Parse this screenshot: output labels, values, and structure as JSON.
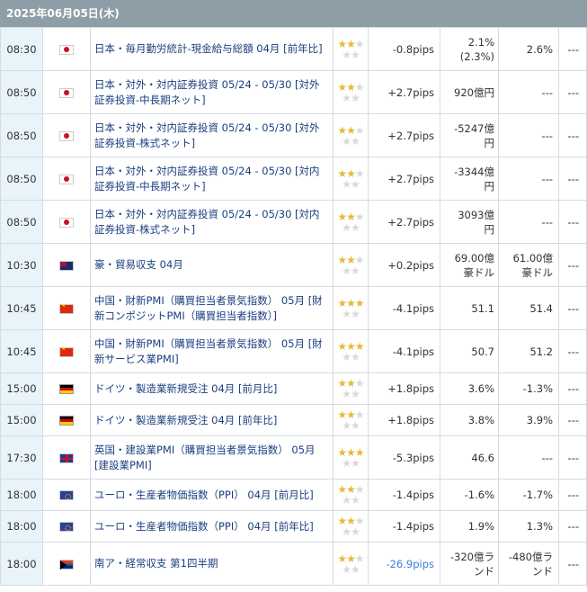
{
  "header": {
    "date": "2025年06月05日(木)"
  },
  "rows": [
    {
      "time": "08:30",
      "flag": "jp",
      "name": "日本・毎月勤労統計-現金給与総額 04月 [前年比]",
      "stars": 2,
      "pips": "-0.8pips",
      "val": "2.1%",
      "val_sub": "(2.3%)",
      "prev": "2.6%",
      "prev2": "---",
      "h": 48
    },
    {
      "time": "08:50",
      "flag": "jp",
      "name": "日本・対外・対内証券投資 05/24 - 05/30 [対外証券投資-中長期ネット]",
      "stars": 2,
      "pips": "+2.7pips",
      "val": "920億円",
      "val_sub": "",
      "prev": "---",
      "prev2": "---",
      "h": 48
    },
    {
      "time": "08:50",
      "flag": "jp",
      "name": "日本・対外・対内証券投資 05/24 - 05/30 [対外証券投資-株式ネット]",
      "stars": 2,
      "pips": "+2.7pips",
      "val": "-5247億",
      "val_sub": "円",
      "prev": "---",
      "prev2": "---",
      "h": 48
    },
    {
      "time": "08:50",
      "flag": "jp",
      "name": "日本・対外・対内証券投資 05/24 - 05/30 [対内証券投資-中長期ネット]",
      "stars": 2,
      "pips": "+2.7pips",
      "val": "-3344億",
      "val_sub": "円",
      "prev": "---",
      "prev2": "---",
      "h": 48
    },
    {
      "time": "08:50",
      "flag": "jp",
      "name": "日本・対外・対内証券投資 05/24 - 05/30 [対内証券投資-株式ネット]",
      "stars": 2,
      "pips": "+2.7pips",
      "val": "3093億",
      "val_sub": "円",
      "prev": "---",
      "prev2": "---",
      "h": 48
    },
    {
      "time": "10:30",
      "flag": "au",
      "name": "豪・貿易収支 04月",
      "stars": 2,
      "pips": "+0.2pips",
      "val": "69.00億",
      "val_sub": "豪ドル",
      "prev": "61.00億",
      "prev_sub": "豪ドル",
      "prev2": "---",
      "h": 48
    },
    {
      "time": "10:45",
      "flag": "cn",
      "name": "中国・財新PMI（購買担当者景気指数） 05月 [財新コンポジットPMI（購買担当者指数）]",
      "stars": 3,
      "pips": "-4.1pips",
      "val": "51.1",
      "val_sub": "",
      "prev": "51.4",
      "prev2": "---",
      "h": 48
    },
    {
      "time": "10:45",
      "flag": "cn",
      "name": "中国・財新PMI（購買担当者景気指数） 05月 [財新サービス業PMI]",
      "stars": 3,
      "pips": "-4.1pips",
      "val": "50.7",
      "val_sub": "",
      "prev": "51.2",
      "prev2": "---",
      "h": 48
    },
    {
      "time": "15:00",
      "flag": "de",
      "name": "ドイツ・製造業新規受注 04月 [前月比]",
      "stars": 2,
      "pips": "+1.8pips",
      "val": "3.6%",
      "val_sub": "",
      "prev": "-1.3%",
      "prev2": "---",
      "h": 35
    },
    {
      "time": "15:00",
      "flag": "de",
      "name": "ドイツ・製造業新規受注 04月 [前年比]",
      "stars": 2,
      "pips": "+1.8pips",
      "val": "3.8%",
      "val_sub": "",
      "prev": "3.9%",
      "prev2": "---",
      "h": 35
    },
    {
      "time": "17:30",
      "flag": "gb",
      "name": "英国・建設業PMI（購買担当者景気指数） 05月 [建設業PMI]",
      "stars": 3,
      "pips": "-5.3pips",
      "val": "46.6",
      "val_sub": "",
      "prev": "---",
      "prev2": "---",
      "h": 48
    },
    {
      "time": "18:00",
      "flag": "eu",
      "name": "ユーロ・生産者物価指数（PPI） 04月 [前月比]",
      "stars": 2,
      "pips": "-1.4pips",
      "val": "-1.6%",
      "val_sub": "",
      "prev": "-1.7%",
      "prev2": "---",
      "h": 35
    },
    {
      "time": "18:00",
      "flag": "eu",
      "name": "ユーロ・生産者物価指数（PPI） 04月 [前年比]",
      "stars": 2,
      "pips": "-1.4pips",
      "val": "1.9%",
      "val_sub": "",
      "prev": "1.3%",
      "prev2": "---",
      "h": 35
    },
    {
      "time": "18:00",
      "flag": "za",
      "name": "南ア・経常収支 第1四半期",
      "stars": 2,
      "pips": "-26.9pips",
      "pips_color": "blue",
      "val": "-320億ラ",
      "val_sub": "ンド",
      "prev": "-480億ラ",
      "prev_sub": "ンド",
      "prev2": "---",
      "h": 48
    }
  ]
}
